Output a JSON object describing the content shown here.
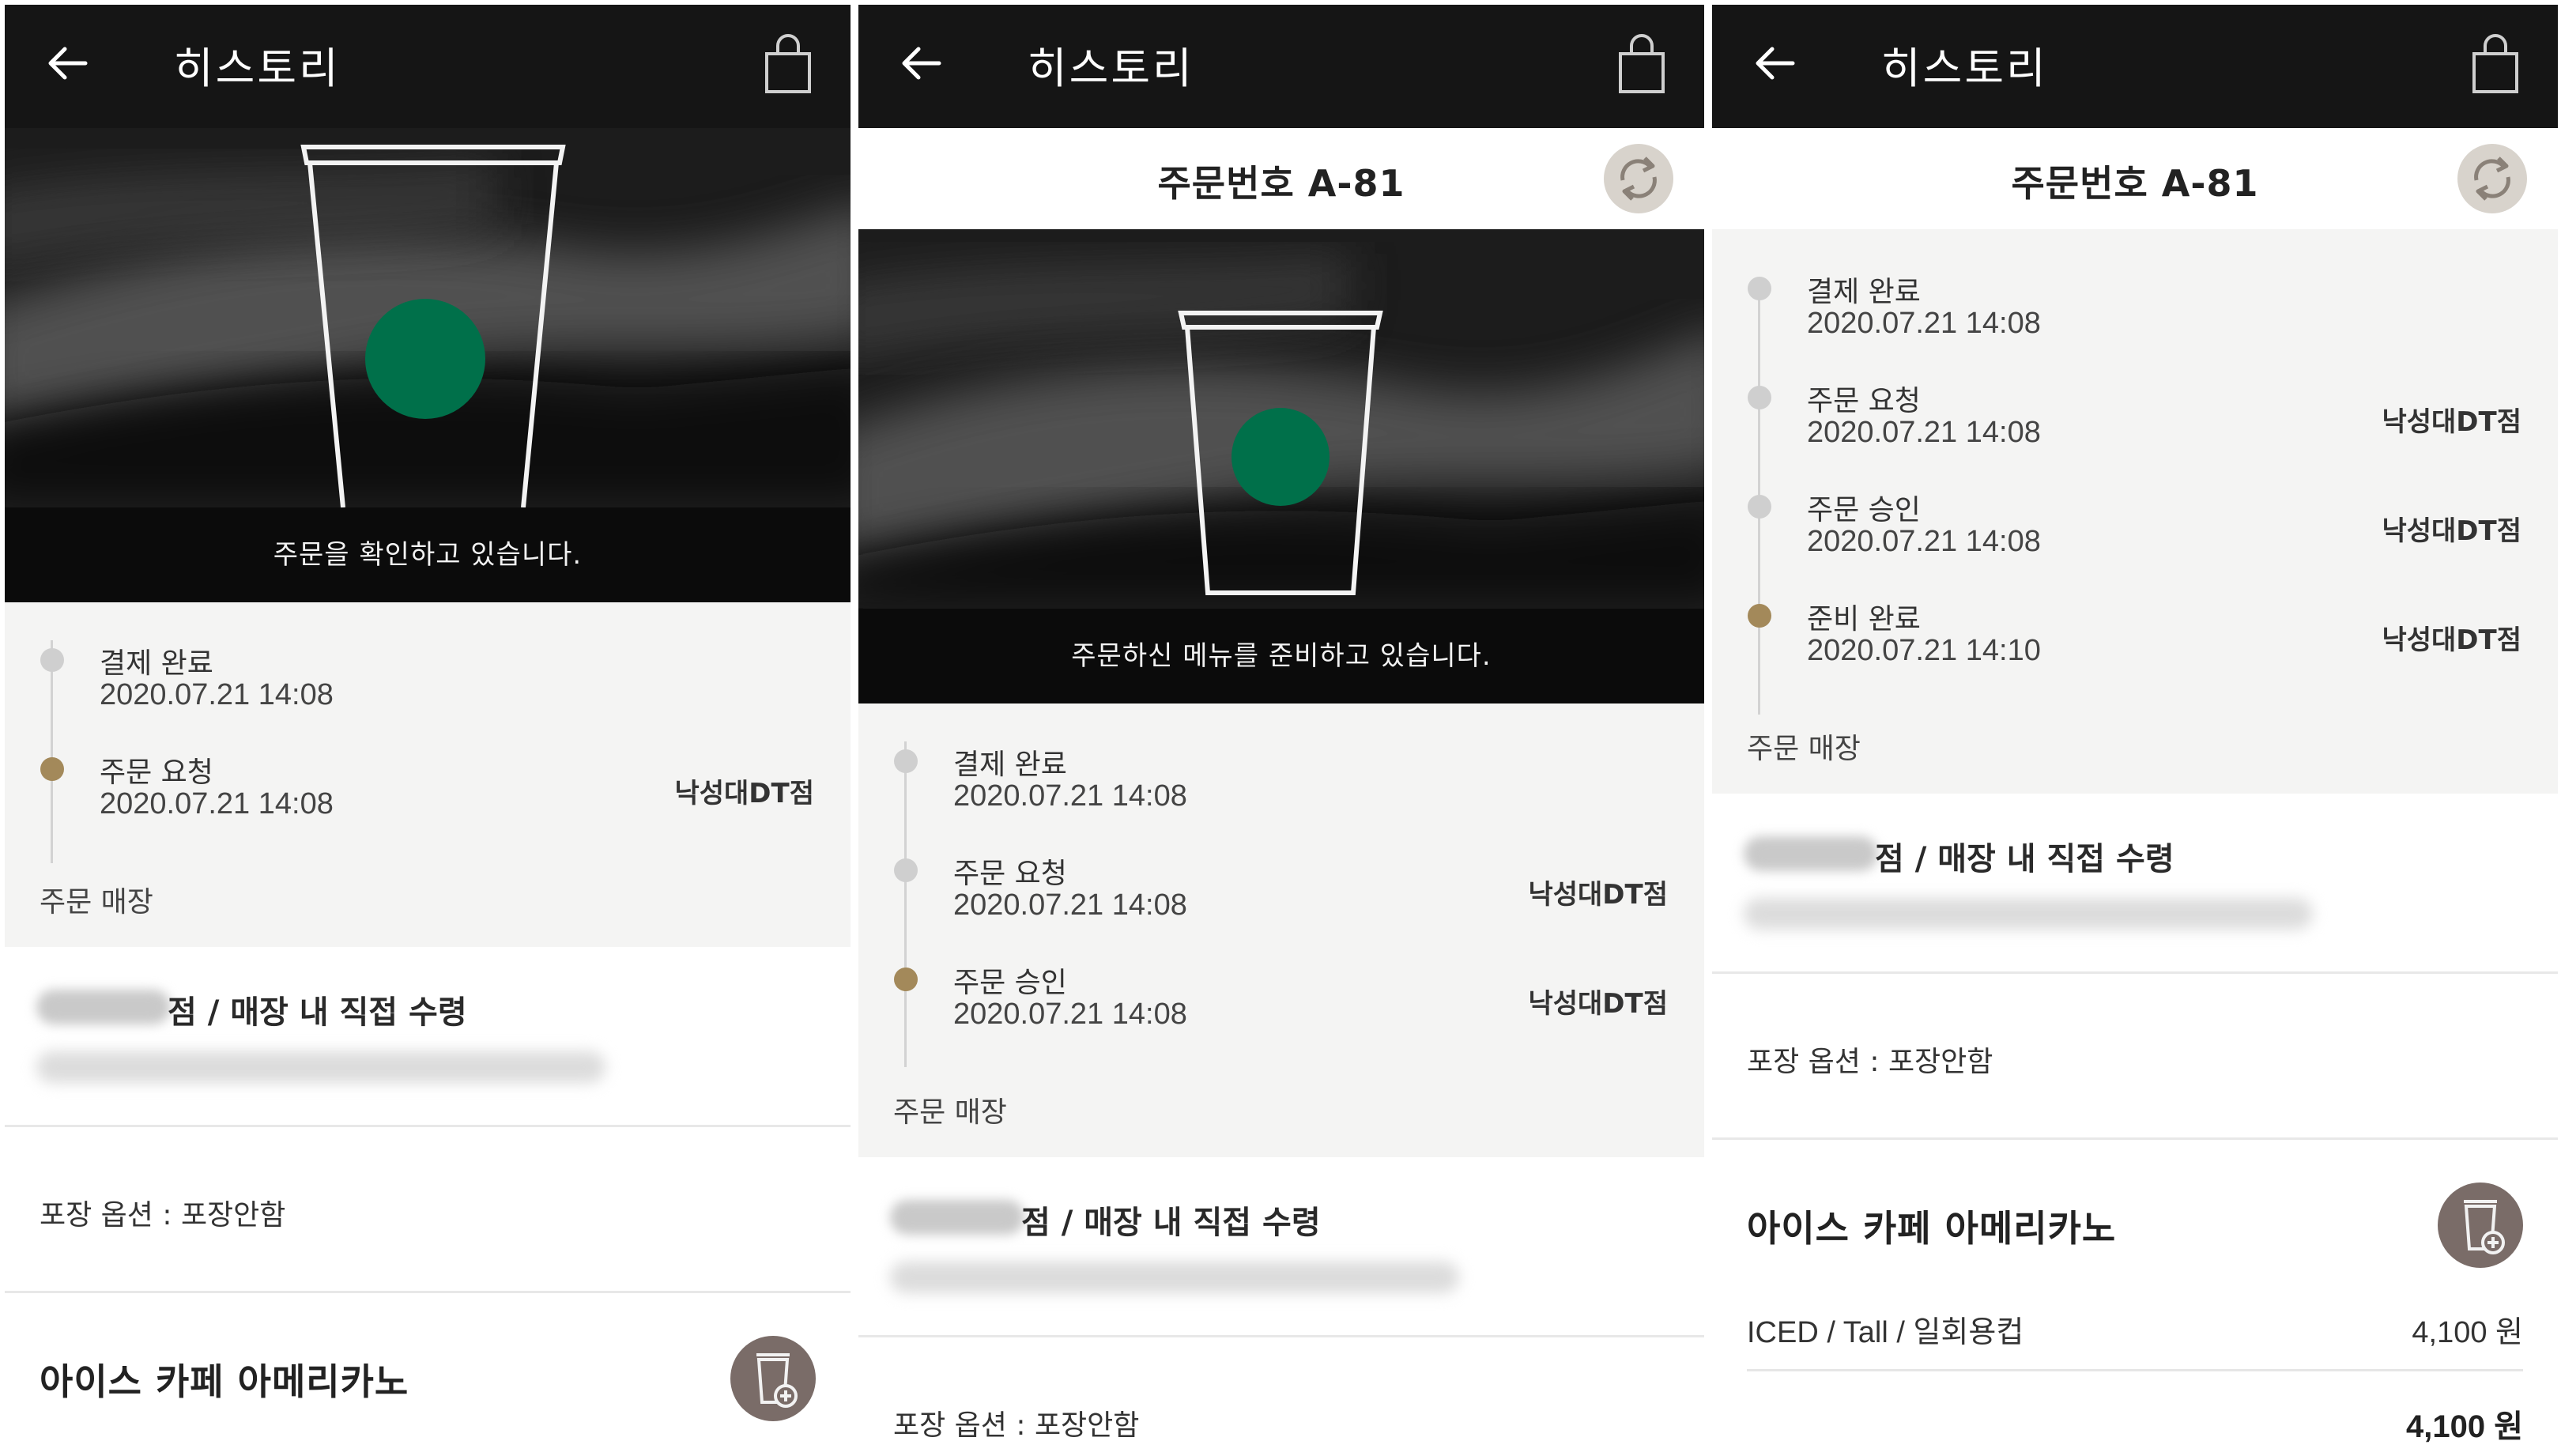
{
  "screens": [
    {
      "header": {
        "title": "히스토리"
      },
      "hero": {
        "caption": "주문을 확인하고 있습니다."
      },
      "timeline": {
        "steps": [
          {
            "label": "결제 완료",
            "time": "2020.07.21 14:08",
            "store": ""
          },
          {
            "label": "주문 요청",
            "time": "2020.07.21 14:08",
            "store": "낙성대DT점"
          }
        ],
        "store_label": "주문 매장"
      },
      "pickup": {
        "text": "점 / 매장 내 직접 수령"
      },
      "packaging": {
        "text": "포장 옵션 : 포장안함"
      },
      "menu": {
        "name": "아이스 카페 아메리카노"
      }
    },
    {
      "header": {
        "title": "히스토리"
      },
      "order": {
        "number": "주문번호 A-81"
      },
      "hero": {
        "caption": "주문하신 메뉴를 준비하고 있습니다."
      },
      "timeline": {
        "steps": [
          {
            "label": "결제 완료",
            "time": "2020.07.21 14:08",
            "store": ""
          },
          {
            "label": "주문 요청",
            "time": "2020.07.21 14:08",
            "store": "낙성대DT점"
          },
          {
            "label": "주문 승인",
            "time": "2020.07.21 14:08",
            "store": "낙성대DT점"
          }
        ],
        "store_label": "주문 매장"
      },
      "pickup": {
        "text": "점 / 매장 내 직접 수령"
      },
      "packaging": {
        "text": "포장 옵션 : 포장안함"
      }
    },
    {
      "header": {
        "title": "히스토리"
      },
      "order": {
        "number": "주문번호 A-81"
      },
      "timeline": {
        "steps": [
          {
            "label": "결제 완료",
            "time": "2020.07.21 14:08",
            "store": ""
          },
          {
            "label": "주문 요청",
            "time": "2020.07.21 14:08",
            "store": "낙성대DT점"
          },
          {
            "label": "주문 승인",
            "time": "2020.07.21 14:08",
            "store": "낙성대DT점"
          },
          {
            "label": "준비 완료",
            "time": "2020.07.21 14:10",
            "store": "낙성대DT점"
          }
        ],
        "store_label": "주문 매장"
      },
      "pickup": {
        "text": "점 / 매장 내 직접 수령"
      },
      "packaging": {
        "text": "포장 옵션 : 포장안함"
      },
      "menu": {
        "name": "아이스 카페 아메리카노",
        "options": "ICED / Tall / 일회용컵",
        "price": "4,100 원",
        "total": "4,100 원"
      }
    }
  ],
  "icons": {
    "back": "arrow-left-icon",
    "bag": "shopping-bag-icon",
    "refresh": "refresh-icon",
    "cup_add": "cup-add-icon",
    "hero_cup": "cup-illustration-icon"
  },
  "colors": {
    "header_bg": "#151515",
    "timeline_bg": "#f4f4f3",
    "active_dot": "#a3895a",
    "inactive_dot": "#cfcfcf",
    "starbucks_green": "#00704a",
    "cup_button": "#7a6c68",
    "refresh_button": "#d8d3cc"
  }
}
